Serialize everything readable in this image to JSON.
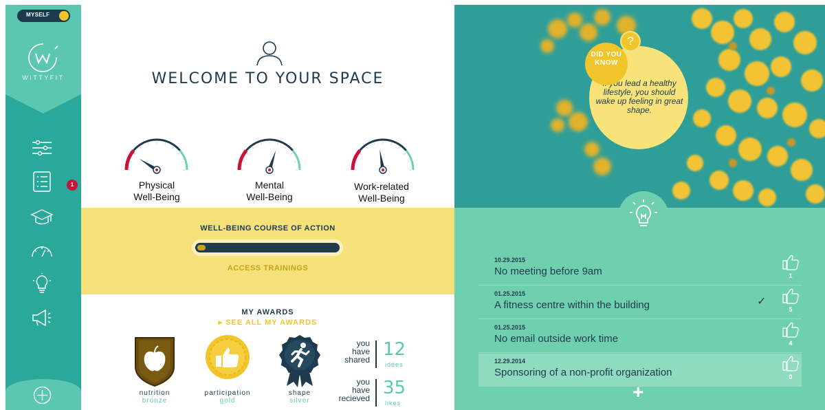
{
  "sidebar": {
    "toggle_label": "MYSELF",
    "logo_text": "WITTYFIT",
    "notification_count": "1",
    "icons": [
      "settings-sliders-icon",
      "checklist-icon",
      "graduation-cap-icon",
      "speedometer-icon",
      "lightbulb-icon",
      "megaphone-icon",
      "add-circle-icon"
    ]
  },
  "main": {
    "title": "WELCOME TO YOUR SPACE",
    "gauges": [
      {
        "label_line1": "Physical",
        "label_line2": "Well-Being",
        "level": 0.18
      },
      {
        "label_line1": "Mental",
        "label_line2": "Well-Being",
        "level": 0.6
      },
      {
        "label_line1": "Work-related",
        "label_line2": "Well-Being",
        "level": 0.45
      }
    ],
    "course": {
      "title": "WELL-BEING COURSE OF ACTION",
      "progress": 0.06,
      "access_label": "ACCESS TRAININGS"
    },
    "awards": {
      "title": "MY AWARDS",
      "see_all": "▸  SEE ALL MY AWARDS",
      "badges": [
        {
          "name": "nutrition",
          "level": "bronze",
          "icon": "apple-icon",
          "color": "#7a5a10"
        },
        {
          "name": "participation",
          "level": "gold",
          "icon": "thumbs-up-icon",
          "color": "#f2c52b"
        },
        {
          "name": "shape",
          "level": "silver",
          "icon": "runner-icon",
          "color": "#1e3a4c"
        }
      ],
      "stats": [
        {
          "line1": "you",
          "line2": "have",
          "line3": "shared",
          "number": "12",
          "unit": "idées"
        },
        {
          "line1": "you",
          "line2": "have",
          "line3": "recieved",
          "number": "35",
          "unit": "likes"
        }
      ]
    }
  },
  "right": {
    "did_you_know": "DID YOU KNOW",
    "question_mark": "?",
    "tip": "If you lead a healthy lifestyle, you should wake up feeling in great shape.",
    "ideas": [
      {
        "date": "10.29.2015",
        "title": "No meeting before 9am",
        "likes": "1",
        "checked": false
      },
      {
        "date": "01.25.2015",
        "title": "A fitness centre within the building",
        "likes": "5",
        "checked": true
      },
      {
        "date": "01.25.2015",
        "title": "No email outside work time",
        "likes": "4",
        "checked": false
      },
      {
        "date": "12.29.2014",
        "title": "Sponsoring of a non-profit organization",
        "likes": "0",
        "checked": false
      }
    ],
    "add_label": "+",
    "check_symbol": "✓"
  },
  "colors": {
    "teal_dark": "#2aa89a",
    "teal_light": "#5cc7b0",
    "mint": "#6fd0b0",
    "navy": "#1e3a4c",
    "yellow": "#f2c52b",
    "pale_yellow": "#f4e17a",
    "red": "#c9143a"
  }
}
